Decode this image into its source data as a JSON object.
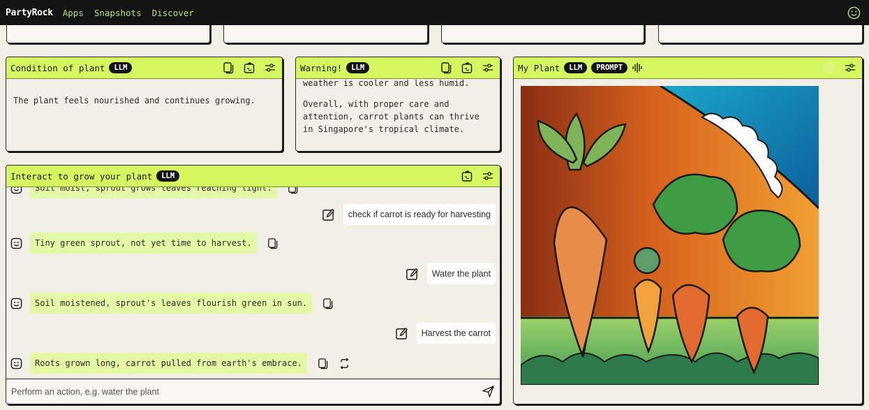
{
  "nav": {
    "brand": "PartyRock",
    "links": [
      "Apps",
      "Snapshots",
      "Discover"
    ],
    "user_icon": "smiley-face-icon"
  },
  "widgets": {
    "condition": {
      "title": "Condition of plant",
      "badge": "LLM",
      "text": "The plant feels nourished and continues growing.",
      "icons": [
        "copy-icon",
        "export-icon",
        "settings-sliders-icon"
      ]
    },
    "warning": {
      "title": "Warning!",
      "badge": "LLM",
      "clipped_line": "weather is cooler and less humid.",
      "text": "Overall, with proper care and attention, carrot plants can thrive in Singapore's tropical climate.",
      "icons": [
        "copy-icon",
        "export-icon",
        "settings-sliders-icon"
      ]
    },
    "my_plant": {
      "title": "My Plant",
      "badges": [
        "LLM",
        "PROMPT"
      ],
      "extra_icon": "audio-waveform-icon",
      "image_alt": "Illustration of four carrots growing in a garden under an orange sky with clouds",
      "icons": [
        "settings-sliders-icon"
      ]
    },
    "chat": {
      "title": "Interact to grow your plant",
      "badge": "LLM",
      "clipped_message": "Soil moist, sprout grows leaves reaching light.",
      "messages": [
        {
          "role": "user",
          "text": "check if carrot is ready for harvesting"
        },
        {
          "role": "ai",
          "text": "Tiny green sprout, not yet time to harvest."
        },
        {
          "role": "user",
          "text": "Water the plant"
        },
        {
          "role": "ai",
          "text": "Soil moistened, sprout's leaves flourish green in sun."
        },
        {
          "role": "user",
          "text": "Harvest the carrot"
        },
        {
          "role": "ai",
          "text": "Roots grown long, carrot pulled from earth's embrace."
        }
      ],
      "input_placeholder": "Perform an action, e.g. water the plant",
      "input_value": ""
    }
  },
  "colors": {
    "accent": "#d4f760",
    "ai_bubble": "#e4f9a6",
    "nav_bg": "#141414",
    "nav_link": "#b9e07a",
    "page_bg": "#f1efe6"
  }
}
